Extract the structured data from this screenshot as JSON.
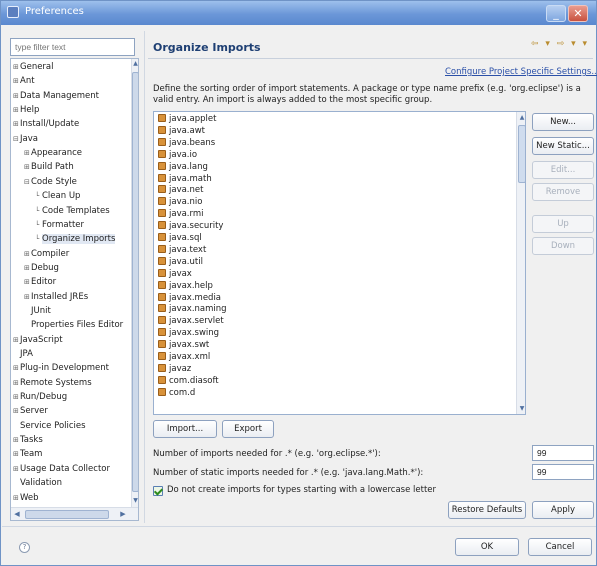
{
  "window": {
    "title": "Preferences"
  },
  "filter": {
    "placeholder": "type filter text"
  },
  "tree": {
    "items": [
      {
        "label": "General",
        "indent": 0,
        "expander": "+"
      },
      {
        "label": "Ant",
        "indent": 0,
        "expander": "+"
      },
      {
        "label": "Data Management",
        "indent": 0,
        "expander": "+"
      },
      {
        "label": "Help",
        "indent": 0,
        "expander": "+"
      },
      {
        "label": "Install/Update",
        "indent": 0,
        "expander": "+"
      },
      {
        "label": "Java",
        "indent": 0,
        "expander": "-"
      },
      {
        "label": "Appearance",
        "indent": 1,
        "expander": "+"
      },
      {
        "label": "Build Path",
        "indent": 1,
        "expander": "+"
      },
      {
        "label": "Code Style",
        "indent": 1,
        "expander": "-"
      },
      {
        "label": "Clean Up",
        "indent": 2,
        "expander": ""
      },
      {
        "label": "Code Templates",
        "indent": 2,
        "expander": ""
      },
      {
        "label": "Formatter",
        "indent": 2,
        "expander": ""
      },
      {
        "label": "Organize Imports",
        "indent": 2,
        "expander": "",
        "selected": true
      },
      {
        "label": "Compiler",
        "indent": 1,
        "expander": "+"
      },
      {
        "label": "Debug",
        "indent": 1,
        "expander": "+"
      },
      {
        "label": "Editor",
        "indent": 1,
        "expander": "+"
      },
      {
        "label": "Installed JREs",
        "indent": 1,
        "expander": "+"
      },
      {
        "label": "JUnit",
        "indent": 1,
        "expander": ""
      },
      {
        "label": "Properties Files Editor",
        "indent": 1,
        "expander": ""
      },
      {
        "label": "JavaScript",
        "indent": 0,
        "expander": "+"
      },
      {
        "label": "JPA",
        "indent": 0,
        "expander": ""
      },
      {
        "label": "Plug-in Development",
        "indent": 0,
        "expander": "+"
      },
      {
        "label": "Remote Systems",
        "indent": 0,
        "expander": "+"
      },
      {
        "label": "Run/Debug",
        "indent": 0,
        "expander": "+"
      },
      {
        "label": "Server",
        "indent": 0,
        "expander": "+"
      },
      {
        "label": "Service Policies",
        "indent": 0,
        "expander": ""
      },
      {
        "label": "Tasks",
        "indent": 0,
        "expander": "+"
      },
      {
        "label": "Team",
        "indent": 0,
        "expander": "+"
      },
      {
        "label": "Usage Data Collector",
        "indent": 0,
        "expander": "+"
      },
      {
        "label": "Validation",
        "indent": 0,
        "expander": ""
      },
      {
        "label": "Web",
        "indent": 0,
        "expander": "+"
      }
    ]
  },
  "page": {
    "title": "Organize Imports",
    "nav": "⇦ ▾ ⇨ ▾ ▾",
    "config_link": "Configure Project Specific Settings...",
    "description": "Define the sorting order of import statements. A package or type name prefix (e.g. 'org.eclipse') is a valid entry. An import is always added to the most specific group."
  },
  "import_order": [
    "java.applet",
    "java.awt",
    "java.beans",
    "java.io",
    "java.lang",
    "java.math",
    "java.net",
    "java.nio",
    "java.rmi",
    "java.security",
    "java.sql",
    "java.text",
    "java.util",
    "javax",
    "javax.help",
    "javax.media",
    "javax.naming",
    "javax.servlet",
    "javax.swing",
    "javax.swt",
    "javax.xml",
    "javaz",
    "com.diasoft",
    "com.d"
  ],
  "side_buttons": {
    "new": "New...",
    "new_static": "New Static...",
    "edit": "Edit...",
    "remove": "Remove",
    "up": "Up",
    "down": "Down"
  },
  "list_buttons": {
    "import": "Import...",
    "export": "Export"
  },
  "fields": {
    "imports_label": "Number of imports needed for .* (e.g. 'org.eclipse.*'):",
    "imports_value": "99",
    "static_label": "Number of static imports needed for .* (e.g. 'java.lang.Math.*'):",
    "static_value": "99",
    "checkbox_label": "Do not create imports for types starting with a lowercase letter"
  },
  "page_buttons": {
    "restore": "Restore Defaults",
    "apply": "Apply"
  },
  "dialog_buttons": {
    "ok": "OK",
    "cancel": "Cancel"
  }
}
